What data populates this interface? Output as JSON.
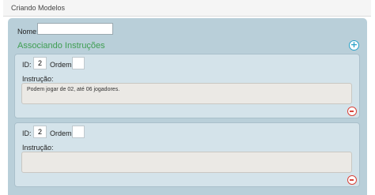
{
  "header": {
    "title": "Criando Modelos"
  },
  "form": {
    "name_label": "Nome:",
    "name_value": "",
    "section_title": "Associando Instruções",
    "add_icon": "plus-circle-icon",
    "remove_icon": "minus-circle-icon",
    "accent_color": "#2aa3c9",
    "section_color": "#3f9e52",
    "remove_color": "#d9443b"
  },
  "instructions": [
    {
      "id_label": "ID:",
      "id_value": "2",
      "ordem_label": "Ordem:",
      "ordem_value": "",
      "instrucao_label": "Instrução:",
      "instrucao_value": "Podem jogar de 02, até 06 jogadores."
    },
    {
      "id_label": "ID:",
      "id_value": "2",
      "ordem_label": "Ordem:",
      "ordem_value": "",
      "instrucao_label": "Instrução:",
      "instrucao_value": ""
    }
  ]
}
